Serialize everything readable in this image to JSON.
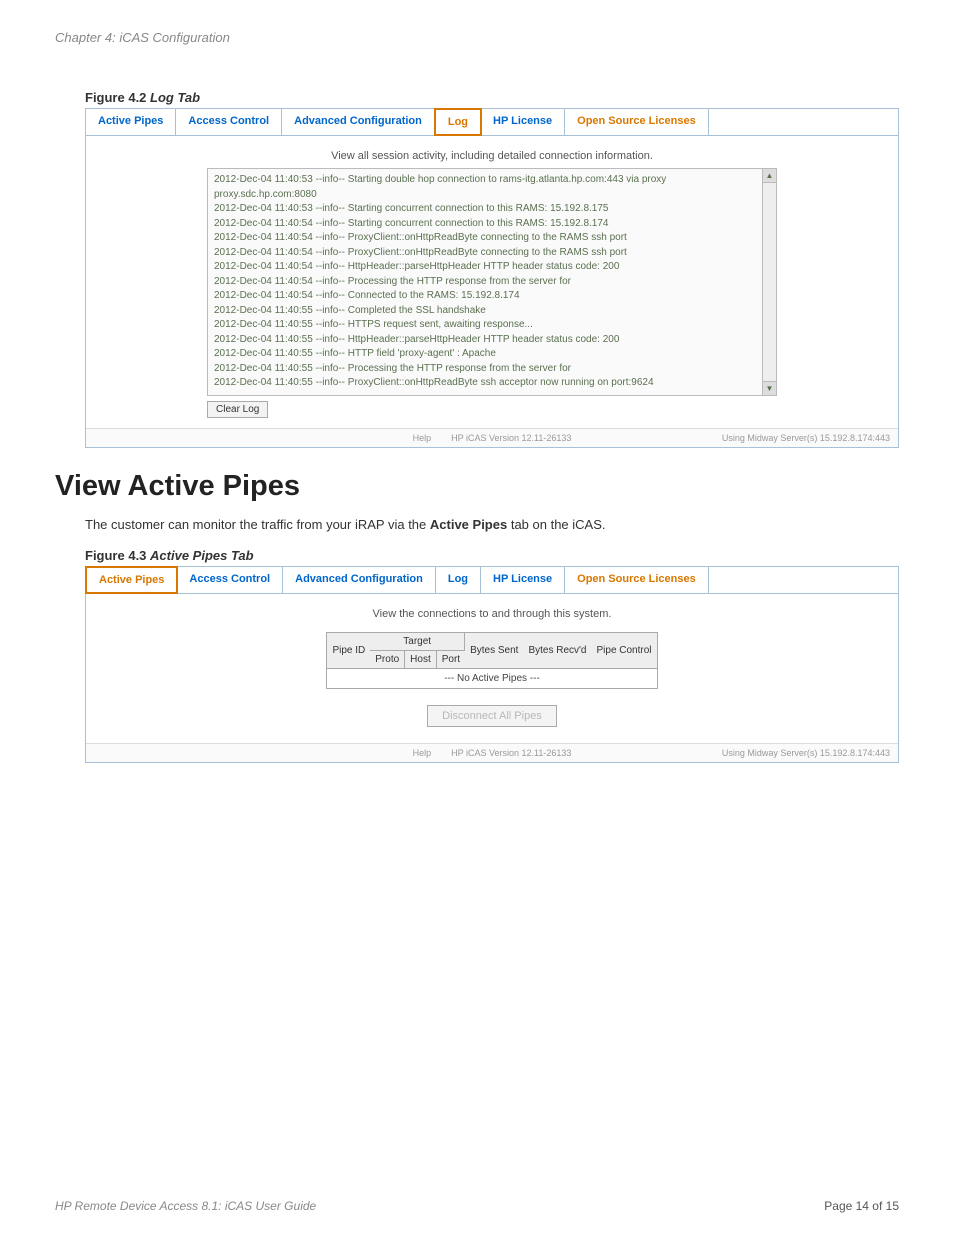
{
  "chapter_header": "Chapter 4: iCAS Configuration",
  "figure42": {
    "prefix": "Figure 4.2 ",
    "title": "Log Tab"
  },
  "tabs": {
    "active_pipes": "Active Pipes",
    "access_control": "Access Control",
    "advanced_config": "Advanced Configuration",
    "log": "Log",
    "hp_license": "HP License",
    "open_source": "Open Source Licenses"
  },
  "log_view_text": "View all session activity, including detailed connection information.",
  "log_lines": [
    "2012-Dec-04 11:40:53 --info-- Starting double hop connection to rams-itg.atlanta.hp.com:443 via proxy proxy.sdc.hp.com:8080",
    "2012-Dec-04 11:40:53 --info-- Starting concurrent connection to this RAMS: 15.192.8.175",
    "2012-Dec-04 11:40:54 --info-- Starting concurrent connection to this RAMS: 15.192.8.174",
    "2012-Dec-04 11:40:54 --info-- ProxyClient::onHttpReadByte connecting to the RAMS ssh port",
    "2012-Dec-04 11:40:54 --info-- ProxyClient::onHttpReadByte connecting to the RAMS ssh port",
    "2012-Dec-04 11:40:54 --info-- HttpHeader::parseHttpHeader HTTP header status code: 200",
    "2012-Dec-04 11:40:54 --info-- Processing the HTTP response from the server for",
    "2012-Dec-04 11:40:54 --info-- Connected to the RAMS: 15.192.8.174",
    "2012-Dec-04 11:40:55 --info-- Completed the SSL handshake",
    "2012-Dec-04 11:40:55 --info-- HTTPS request sent, awaiting response...",
    "2012-Dec-04 11:40:55 --info-- HttpHeader::parseHttpHeader HTTP header status code: 200",
    "2012-Dec-04 11:40:55 --info-- HTTP field 'proxy-agent' : Apache",
    "2012-Dec-04 11:40:55 --info-- Processing the HTTP response from the server for",
    "2012-Dec-04 11:40:55 --info-- ProxyClient::onHttpReadByte  ssh acceptor now running on port:9624"
  ],
  "clear_log": "Clear Log",
  "app_footer": {
    "help": "Help",
    "version": "HP iCAS Version 12.11-26133",
    "server": "Using Midway Server(s) 15.192.8.174:443"
  },
  "section_title": "View Active Pipes",
  "body_text_pre": "The customer can monitor the traffic from your iRAP via the ",
  "body_text_bold": "Active Pipes",
  "body_text_post": " tab on the iCAS.",
  "figure43": {
    "prefix": "Figure 4.3 ",
    "title": "Active Pipes Tab"
  },
  "pipes_view_text": "View the connections to and through this system.",
  "pipe_headers": {
    "pipe_id": "Pipe ID",
    "target": "Target",
    "proto": "Proto",
    "host": "Host",
    "port": "Port",
    "bytes_sent": "Bytes Sent",
    "bytes_recvd": "Bytes Recv'd",
    "pipe_control": "Pipe Control"
  },
  "no_active": "--- No Active Pipes ---",
  "disconnect_all": "Disconnect All Pipes",
  "footer": {
    "left": "HP Remote Device Access 8.1: iCAS User Guide",
    "right": "Page 14 of 15"
  }
}
